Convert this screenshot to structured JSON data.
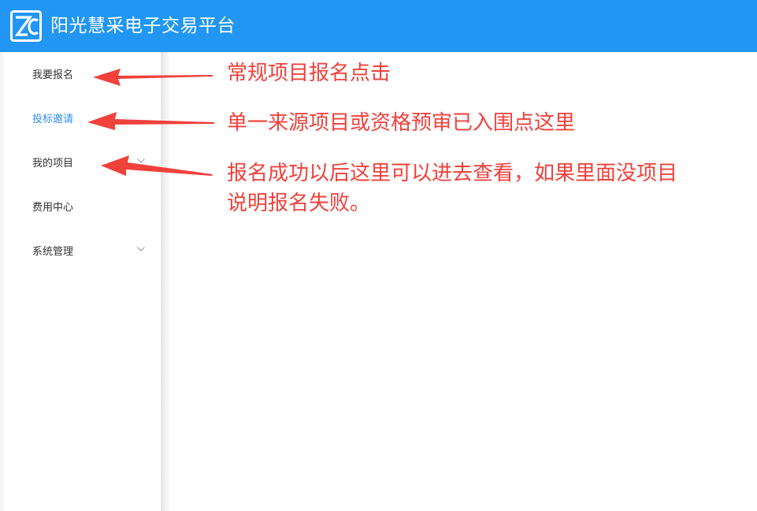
{
  "header": {
    "title": "阳光慧采电子交易平台",
    "logo_icon": "zc-logo-icon",
    "background_color": "#2196f3"
  },
  "sidebar": {
    "items": [
      {
        "label": "我要报名",
        "active": false,
        "has_submenu": false
      },
      {
        "label": "投标邀请",
        "active": true,
        "has_submenu": false
      },
      {
        "label": "我的项目",
        "active": false,
        "has_submenu": true
      },
      {
        "label": "费用中心",
        "active": false,
        "has_submenu": false
      },
      {
        "label": "系统管理",
        "active": false,
        "has_submenu": true
      }
    ],
    "active_color": "#2d8cf0"
  },
  "annotations": {
    "color": "#f0413b",
    "items": [
      {
        "lines": [
          "常规项目报名点击"
        ]
      },
      {
        "lines": [
          "单一来源项目或资格预审已入围点这里"
        ]
      },
      {
        "lines": [
          "报名成功以后这里可以进去查看，如果里面没项目",
          "说明报名失败。"
        ]
      }
    ]
  }
}
